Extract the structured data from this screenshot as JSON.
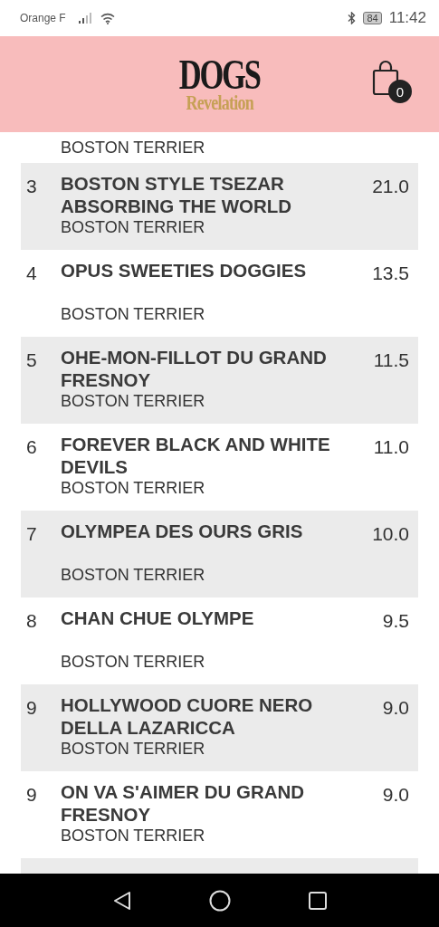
{
  "status_bar": {
    "carrier": "Orange F",
    "battery": "84",
    "time": "11:42"
  },
  "header": {
    "logo_top": "DOGS",
    "logo_bottom": "Revelation",
    "cart_count": "0"
  },
  "partial_row": {
    "breed": "BOSTON TERRIER"
  },
  "rows": [
    {
      "rank": "3",
      "name": "BOSTON STYLE TSEZAR ABSORBING THE WORLD",
      "score": "21.0",
      "breed": "BOSTON TERRIER"
    },
    {
      "rank": "4",
      "name": "OPUS SWEETIES DOGGIES",
      "score": "13.5",
      "breed": "BOSTON TERRIER"
    },
    {
      "rank": "5",
      "name": "OHE-MON-FILLOT DU GRAND FRESNOY",
      "score": "11.5",
      "breed": "BOSTON TERRIER"
    },
    {
      "rank": "6",
      "name": "FOREVER BLACK AND WHITE DEVILS",
      "score": "11.0",
      "breed": "BOSTON TERRIER"
    },
    {
      "rank": "7",
      "name": "OLYMPEA DES OURS GRIS",
      "score": "10.0",
      "breed": "BOSTON TERRIER"
    },
    {
      "rank": "8",
      "name": "CHAN CHUE OLYMPE",
      "score": "9.5",
      "breed": "BOSTON TERRIER"
    },
    {
      "rank": "9",
      "name": "HOLLYWOOD CUORE NERO DELLA LAZARICCA",
      "score": "9.0",
      "breed": "BOSTON TERRIER"
    },
    {
      "rank": "9",
      "name": "ON VA S'AIMER DU GRAND FRESNOY",
      "score": "9.0",
      "breed": "BOSTON TERRIER"
    }
  ]
}
